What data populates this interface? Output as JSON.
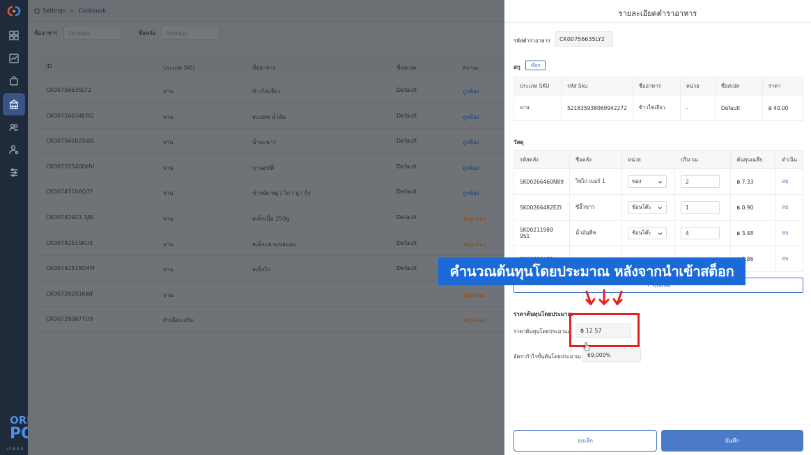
{
  "sidebar": {
    "brand_top": "ORDER",
    "brand_bottom": "POS",
    "version": "v1.8.4.4",
    "icons": [
      "grid-icon",
      "chart-icon",
      "bag-icon",
      "building-icon",
      "users-icon",
      "user-settings-icon",
      "sliders-icon"
    ]
  },
  "breadcrumb": {
    "root": "Settings",
    "current": "Cookbook"
  },
  "filters": [
    {
      "label": "ชื่ออาหาร",
      "placeholder": "ป้อนข้อมูล"
    },
    {
      "label": "ชื่อคลัง",
      "placeholder": "ป้อนข้อมูล"
    }
  ],
  "list": {
    "columns": [
      "ID",
      "ประเภท SKU",
      "ชื่ออาหาร",
      "ชื่อสเปค",
      "สถานะ"
    ],
    "rows": [
      {
        "id": "CK00756635LY2",
        "type": "จาน",
        "name": "ข้าวไข่เจียว",
        "spec": "Default",
        "status": "ถูกต้อง",
        "ok": true
      },
      {
        "id": "CK00756634ERQ",
        "type": "จาน",
        "name": "สแปลช น้ำส้ม",
        "spec": "Default",
        "status": "ถูกต้อง",
        "ok": true
      },
      {
        "id": "CK00756602SW5",
        "type": "จาน",
        "name": "น้ำมะนาว",
        "spec": "Default",
        "status": "ถูกต้อง",
        "ok": true
      },
      {
        "id": "CK00755540DHV",
        "type": "จาน",
        "name": "บานอฟฟี่",
        "spec": "Default",
        "status": "ถูกต้อง",
        "ok": true
      },
      {
        "id": "CK00743106Q7F",
        "type": "จาน",
        "name": "ข้าวผัด หมู / ไก่ / ปู / กุ้ง",
        "spec": "Default",
        "status": "ถูกต้อง",
        "ok": true
      },
      {
        "id": "CK00742921 3JN",
        "type": "จาน",
        "name": "สเต็กเนื้อ 250g.",
        "spec": "Default",
        "status": "ไม่ถูกต้อง",
        "ok": false
      },
      {
        "id": "CK00742519KUE",
        "type": "จาน",
        "name": "สเต็กปลาแซลมอน",
        "spec": "Default",
        "status": "ไม่ถูกต้อง",
        "ok": false
      },
      {
        "id": "CK00742518O4M",
        "type": "จาน",
        "name": "สเต็กไก่",
        "spec": "Default",
        "status": "ไม่ถูกต้อง",
        "ok": false
      },
      {
        "id": "CK00739291KWF",
        "type": "จาน",
        "name": "",
        "spec": "",
        "status": "ไม่ถูกต้อง",
        "ok": false
      },
      {
        "id": "CK00728087TU9",
        "type": "ตัวเลือกเสริม",
        "name": "",
        "spec": "",
        "status": "ไม่ถูกต้อง",
        "ok": false
      }
    ]
  },
  "drawer": {
    "title": "รายละเอียดตำราอาหาร",
    "recipe_id_label": "รหัสตำราอาหาร",
    "recipe_id": "CK00756635LY2",
    "sku_section": "สกุ",
    "choose_label": "เลือก",
    "sku_columns": [
      "ประเภท SKU",
      "รหัส Sku",
      "ชื่ออาหาร",
      "หน่วย",
      "ชื่อสเปค",
      "ราคา"
    ],
    "sku_row": [
      "จาน",
      "521835938069942272",
      "ข้าวไข่เจียว",
      "-",
      "Default",
      "฿ 40.00"
    ],
    "material_section": "วัสดุ",
    "material_columns": [
      "รหัสคลัง",
      "ชื่อคลัง",
      "หน่วย",
      "ปริมาณ",
      "ต้นทุนเฉลี่ย",
      "ดำเนิน"
    ],
    "materials": [
      {
        "code": "SK00266460N89",
        "name": "ไข่ไก่ เบอร์ 1",
        "unit": "ฟอง",
        "qty": "2",
        "cost": "฿ 7.33",
        "action": "ลบ"
      },
      {
        "code": "SK00266482EZI",
        "name": "ซีอิ๊วขาว",
        "unit": "ช้อนโต๊ะ",
        "qty": "1",
        "cost": "฿ 0.90",
        "action": "ลบ"
      },
      {
        "code": "SK00211989 9S1",
        "name": "น้ำมันพืช",
        "unit": "ช้อนโต๊ะ",
        "qty": "4",
        "cost": "฿ 3.48",
        "action": "ลบ"
      },
      {
        "code": "SK00266482...",
        "name": "",
        "unit": "",
        "qty": "",
        "cost": "฿ 0.86",
        "action": "ลบ"
      }
    ],
    "add_label": "+ คุณเพิ่ม",
    "cost_section": "ราคาต้นทุนโดยประมาณ",
    "cost_label": "ราคาต้นทุนโดยประมาณ",
    "cost_value": "฿ 12.57",
    "margin_label": "อัตรากำไรขั้นต้นโดยประมาณ",
    "margin_value": "69.000%",
    "cancel_label": "ยกเลิก",
    "save_label": "บันทึก"
  },
  "overlay": {
    "banner": "คำนวณต้นทุนโดยประมาณ หลังจากนำเข้าสต็อก",
    "banner_color": "#1a6bd8",
    "highlight_color": "#e51e1e"
  }
}
